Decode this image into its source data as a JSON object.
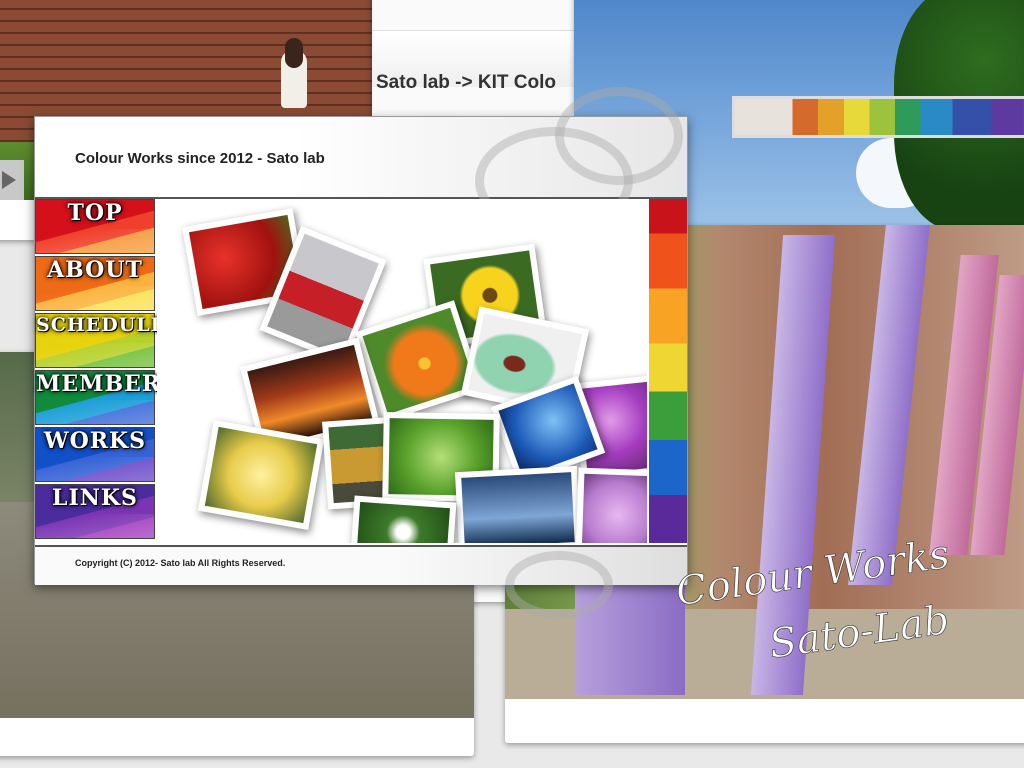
{
  "background": {
    "kit_page_title": "Sato lab -> KIT Colo"
  },
  "window": {
    "site_title": "Colour Works since 2012 - Sato lab",
    "copyright": "Copyright (C) 2012-  Sato lab All Rights Reserved."
  },
  "nav": {
    "items": [
      {
        "label": "TOP"
      },
      {
        "label": "ABOUT"
      },
      {
        "label": "SCHEDULE"
      },
      {
        "label": "MEMBER"
      },
      {
        "label": "WORKS"
      },
      {
        "label": "LINKS"
      }
    ]
  },
  "overlay": {
    "line1": "Colour Works",
    "line2": "Sato-Lab"
  },
  "colors": {
    "nav_top": "#d4101b",
    "nav_about": "#ef6a16",
    "nav_schedule": "#e7d30d",
    "nav_member": "#0f8b3b",
    "nav_works": "#1150c8",
    "nav_links": "#4a2c9e"
  },
  "icons": [
    "play-icon"
  ]
}
